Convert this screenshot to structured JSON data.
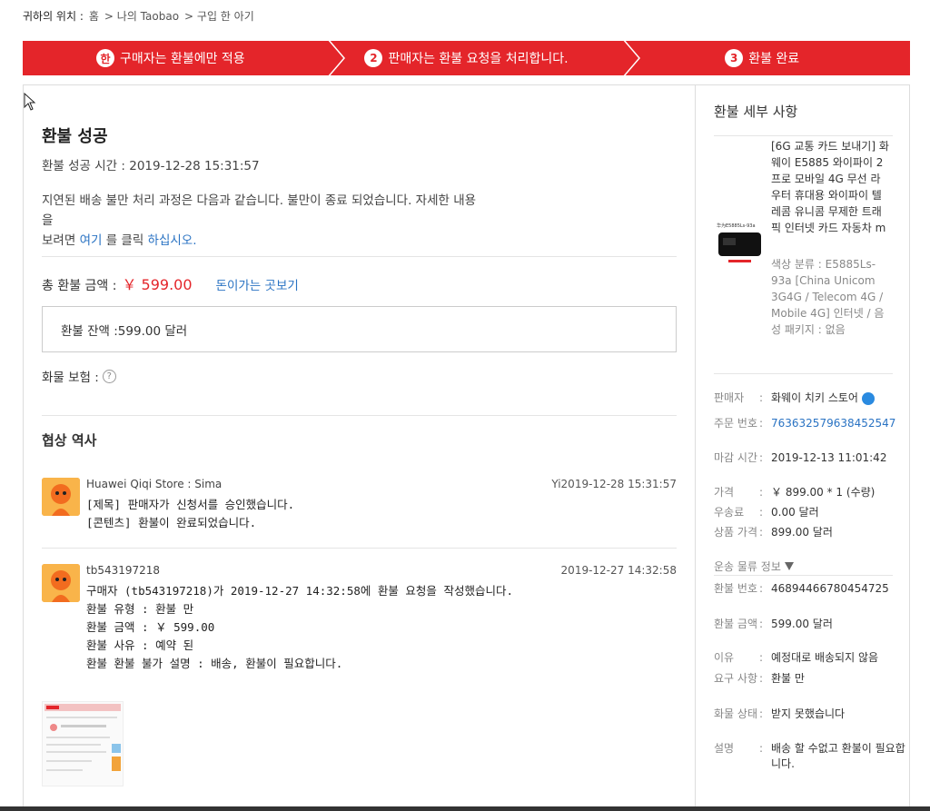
{
  "breadcrumb": {
    "lead": "귀하의 위치 :",
    "items": [
      "홈",
      "> 나의 Taobao",
      "> 구입 한 아기"
    ]
  },
  "steps": [
    {
      "num": "한",
      "label": "구매자는 환불에만 적용"
    },
    {
      "num": "2",
      "label": "판매자는 환불 요청을 처리합니다."
    },
    {
      "num": "3",
      "label": "환불 완료"
    }
  ],
  "colors": {
    "accent": "#e4252a",
    "link": "#2a73c3"
  },
  "main": {
    "status_title": "환불 성공",
    "success_time": "환불 성공 시간 : 2019-12-28 15:31:57",
    "desc_part1": "지연된 배송 불만 처리 과정은 다음과 같습니다. 불만이 종료 되었습니다. 자세한 내용",
    "desc_part2": "을",
    "desc_part3": "보려면 ",
    "desc_link1": "여기",
    "desc_part4": " 를 클릭 ",
    "desc_link2": "하십시오.",
    "total_label": "총 환불 금액 :",
    "total_amount": "￥ 599.00",
    "money_link": "돈이가는 곳보기",
    "balance": "환불 잔액 :599.00 달러",
    "insurance_label": "화물 보험 :",
    "insurance_icon": "?",
    "history_title": "협상 역사",
    "messages": [
      {
        "who": "Huawei Qiqi Store : Sima",
        "when": "Yi2019-12-28 15:31:57",
        "body": "[제목] 판매자가 신청서를 승인했습니다.\n[콘텐츠] 환불이 완료되었습니다."
      },
      {
        "who": "tb543197218",
        "when": "2019-12-27 14:32:58",
        "body": "구매자 (tb543197218)가 2019-12-27 14:32:58에 환불 요청을 작성했습니다.\n환불 유형 : 환불 만\n환불 금액 : ￥ 599.00\n환불 사유 : 예약 된\n환불 환불 불가 설명 : 배송, 환불이 필요합니다."
      }
    ]
  },
  "side": {
    "title": "환불 세부 사항",
    "product_name": "[6G 교통 카드 보내기] 화웨이 E5885 와이파이 2 프로 모바일 4G 무선 라우터 휴대용 와이파이 텔레콤 유니콤 무제한 트래픽 인터넷 카드 자동차 m",
    "product_attr": "색상 분류 : E5885Ls-93a [China Unicom 3G4G / Telecom 4G / Mobile 4G] 인터넷 / 음성 패키지 : 없음",
    "rows1": [
      {
        "k": "판매자",
        "v": "화웨이 치키 스토어",
        "badge": true
      },
      {
        "k": "주문 번호",
        "v": "763632579638452547",
        "link": true
      },
      {
        "k": "마감 시간",
        "v": "2019-12-13 11:01:42"
      },
      {
        "k": "가격",
        "v": "￥ 899.00 * 1 (수량)"
      },
      {
        "k": "우송료",
        "v": "0.00 달러"
      },
      {
        "k": "상품 가격",
        "v": "899.00 달러"
      }
    ],
    "logistics": "운송 물류 정보",
    "rows2": [
      {
        "k": "환불 번호",
        "v": "46894466780454725"
      },
      {
        "k": "환불 금액",
        "v": "599.00 달러"
      },
      {
        "k": "이유",
        "v": "예정대로 배송되지 않음"
      },
      {
        "k": "요구 사항",
        "v": "환불 만"
      },
      {
        "k": "화물 상태",
        "v": "받지 못했습니다"
      },
      {
        "k": "설명",
        "v": "배송 할 수없고 환불이 필요합니다."
      }
    ]
  }
}
